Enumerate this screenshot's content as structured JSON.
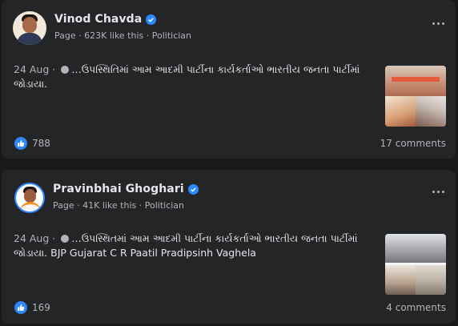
{
  "posts": [
    {
      "author": "Vinod Chavda",
      "subtitle": "Page · 623K like this · Politician",
      "date": "24 Aug · ",
      "text": "…ઉપસ્થિતિમાં આમ આદમી પાર્ટીના કાર્યકર્તાઓ ભારતીય જનતા પાર્ટીમાં જોડાયા.",
      "likes": "788",
      "comments": "17 comments"
    },
    {
      "author": "Pravinbhai Ghoghari",
      "subtitle": "Page · 41K like this · Politician",
      "date": "24 Aug · ",
      "text": "…ઉપસ્થિતમાં આમ આદમી પાર્ટીના કાર્યકર્તાઓ ભારતીય જનતા પાર્ટીમાં જોડાયા. BJP Gujarat C R Paatil Pradipsinh Vaghela",
      "likes": "169",
      "comments": "4 comments"
    }
  ],
  "colors": {
    "background": "#18191a",
    "card": "#242526",
    "primary_text": "#e4e6eb",
    "secondary_text": "#b0b3b8",
    "accent": "#2d88ff"
  },
  "icons": [
    "verified-badge-icon",
    "globe-icon",
    "more-options-icon",
    "like-reaction-icon"
  ]
}
